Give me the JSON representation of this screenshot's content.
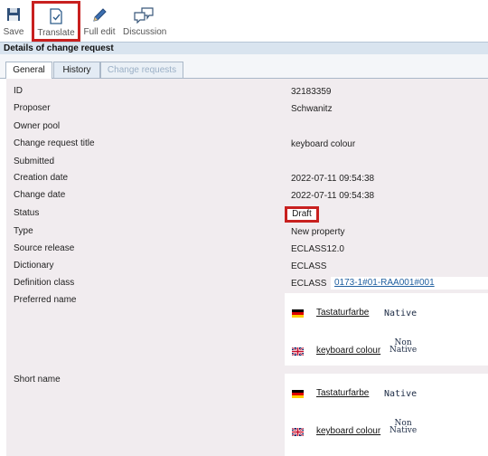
{
  "toolbar": {
    "save": "Save",
    "translate": "Translate",
    "full_edit": "Full edit",
    "discussion": "Discussion"
  },
  "section_title": "Details of change request",
  "tabs": [
    "General",
    "History",
    "Change requests"
  ],
  "fields": {
    "id": {
      "label": "ID",
      "value": "32183359"
    },
    "proposer": {
      "label": "Proposer",
      "value": "Schwanitz"
    },
    "owner_pool": {
      "label": "Owner pool",
      "value": ""
    },
    "title": {
      "label": "Change request title",
      "value": "keyboard colour"
    },
    "submitted": {
      "label": "Submitted",
      "value": ""
    },
    "creation_date": {
      "label": "Creation date",
      "value": "2022-07-11 09:54:38"
    },
    "change_date": {
      "label": "Change date",
      "value": "2022-07-11 09:54:38"
    },
    "status": {
      "label": "Status",
      "value": "Draft"
    },
    "type": {
      "label": "Type",
      "value": "New property"
    },
    "source_release": {
      "label": "Source release",
      "value": "ECLASS12.0"
    },
    "dictionary": {
      "label": "Dictionary",
      "value": "ECLASS"
    },
    "definition_class": {
      "label": "Definition class",
      "value": "ECLASS",
      "link": "0173-1#01-RAA001#001"
    },
    "preferred_name": {
      "label": "Preferred name"
    },
    "short_name": {
      "label": "Short name"
    }
  },
  "preferred_names": [
    {
      "flag": "de-flag-icon",
      "text": "Tastaturfarbe",
      "tag": "Native"
    },
    {
      "flag": "uk-flag-icon",
      "text": "keyboard colour",
      "tag_top": "Non",
      "tag_bottom": "Native"
    }
  ],
  "short_names": [
    {
      "flag": "de-flag-icon",
      "text": "Tastaturfarbe",
      "tag": "Native"
    },
    {
      "flag": "uk-flag-icon",
      "text": "keyboard colour",
      "tag_top": "Non",
      "tag_bottom": "Native"
    }
  ],
  "colors": {
    "highlight": "#c8201f",
    "header_bg": "#d9e4ef",
    "panel_bg": "#f1ecef"
  }
}
